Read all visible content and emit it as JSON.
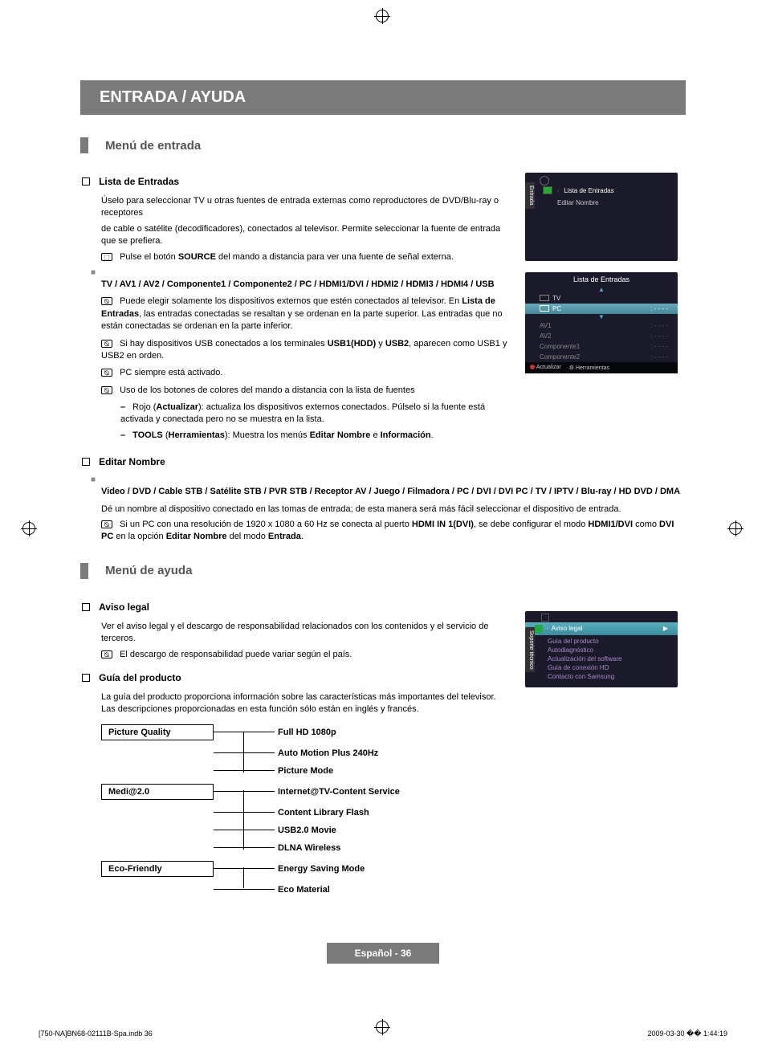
{
  "banner": "ENTRADA / AYUDA",
  "section1": {
    "title": "Menú de entrada",
    "lista": {
      "title": "Lista de Entradas",
      "p1": "Úselo para seleccionar TV u otras fuentes de entrada externas como reproductores de DVD/Blu-ray o receptores",
      "p2": "de cable o satélite (decodificadores), conectados al televisor. Permite seleccionar la fuente de entrada que se prefiera.",
      "p3_pre": "Pulse el botón ",
      "p3_b": "SOURCE",
      "p3_post": " del mando a distancia para ver una fuente de señal externa.",
      "sources_title": "TV / AV1 / AV2 / Componente1 / Componente2 / PC / HDMI1/DVI / HDMI2 / HDMI3 / HDMI4 / USB",
      "n1_a": "Puede elegir solamente los dispositivos externos que estén conectados al televisor. En ",
      "n1_b": "Lista de Entradas",
      "n1_c": ", las entradas conectadas se resaltan y se ordenan en la parte superior. Las entradas que no están conectadas se ordenan en la parte inferior.",
      "n2_a": "Si hay dispositivos USB conectados a los terminales ",
      "n2_b1": "USB1(HDD)",
      "n2_mid": " y ",
      "n2_b2": "USB2",
      "n2_c": ", aparecen como USB1 y USB2 en orden.",
      "n3": "PC siempre está activado.",
      "n4": "Uso de los botones de colores del mando a distancia con la lista de fuentes",
      "d1_a": "Rojo (",
      "d1_b": "Actualizar",
      "d1_c": "): actualiza los dispositivos externos conectados. Púlselo si la fuente está activada y conectada pero no se muestra en la lista.",
      "d2_a": "TOOLS",
      "d2_b": " (",
      "d2_c": "Herramientas",
      "d2_d": "): Muestra los menús ",
      "d2_e": "Editar Nombre",
      "d2_f": " e ",
      "d2_g": "Información",
      "d2_h": "."
    },
    "editar": {
      "title": "Editar Nombre",
      "options": "Video / DVD / Cable STB / Satélite STB / PVR STB / Receptor AV / Juego / Filmadora / PC / DVI / DVI PC / TV / IPTV / Blu-ray / HD DVD / DMA",
      "p1": "Dé un nombre al dispositivo conectado en las tomas de entrada; de esta manera será más fácil seleccionar el dispositivo de entrada.",
      "n1_a": "Si un PC con una resolución de 1920 x 1080 a 60 Hz se conecta al puerto ",
      "n1_b": "HDMI IN 1(DVI)",
      "n1_c": ", se debe configurar el modo ",
      "n1_d": "HDMI1/DVI",
      "n1_e": " como ",
      "n1_f": "DVI PC",
      "n1_g": " en la opción ",
      "n1_h": "Editar Nombre",
      "n1_i": " del modo ",
      "n1_j": "Entrada",
      "n1_k": "."
    }
  },
  "section2": {
    "title": "Menú de ayuda",
    "aviso": {
      "title": "Aviso legal",
      "p1": "Ver el aviso legal y el descargo de responsabilidad relacionados con los contenidos y el servicio de terceros.",
      "n1": "El descargo de responsabilidad puede variar según el país."
    },
    "guia": {
      "title": "Guía del producto",
      "p1": "La guía del producto proporciona información sobre las características más importantes del televisor. Las descripciones proporcionadas en esta función sólo están en inglés y francés."
    }
  },
  "chart_data": {
    "type": "table",
    "title": "Product Guide feature tree",
    "rows": [
      {
        "category": "Picture Quality",
        "features": [
          "Full HD 1080p",
          "Auto Motion Plus 240Hz",
          "Picture Mode"
        ]
      },
      {
        "category": "Medi@2.0",
        "features": [
          "Internet@TV-Content Service",
          "Content Library Flash",
          "USB2.0 Movie",
          "DLNA Wireless"
        ]
      },
      {
        "category": "Eco-Friendly",
        "features": [
          "Energy Saving Mode",
          "Eco Material"
        ]
      }
    ]
  },
  "tree": {
    "g1": "Picture Quality",
    "g1_items": [
      "Full HD 1080p",
      "Auto Motion Plus 240Hz",
      "Picture Mode"
    ],
    "g2": "Medi@2.0",
    "g2_items": [
      "Internet@TV-Content Service",
      "Content Library Flash",
      "USB2.0 Movie",
      "DLNA Wireless"
    ],
    "g3": "Eco-Friendly",
    "g3_items": [
      "Energy Saving Mode",
      "Eco Material"
    ]
  },
  "screenshot1": {
    "tab": "Entrada",
    "item1": "Lista de Entradas",
    "item2": "Editar Nombre"
  },
  "screenshot2": {
    "title": "Lista de Entradas",
    "tv": "TV",
    "pc": "PC",
    "av1": "AV1",
    "av2": "AV2",
    "c1": "Componente1",
    "c2": "Componente2",
    "dash": ": - - - -",
    "foot1": "Actualizar",
    "foot2": "Herramientas"
  },
  "screenshot3": {
    "tab": "Soporte técnico",
    "sel": "Aviso legal",
    "i1": "Guía del producto",
    "i2": "Autodiagnóstico",
    "i3": "Actualización del software",
    "i4": "Guía de conexión HD",
    "i5": "Contacto con Samsung"
  },
  "footer": "Español - 36",
  "meta_left": "[750-NA]BN68-02111B-Spa.indb   36",
  "meta_right": "2009-03-30   �� 1:44:19"
}
